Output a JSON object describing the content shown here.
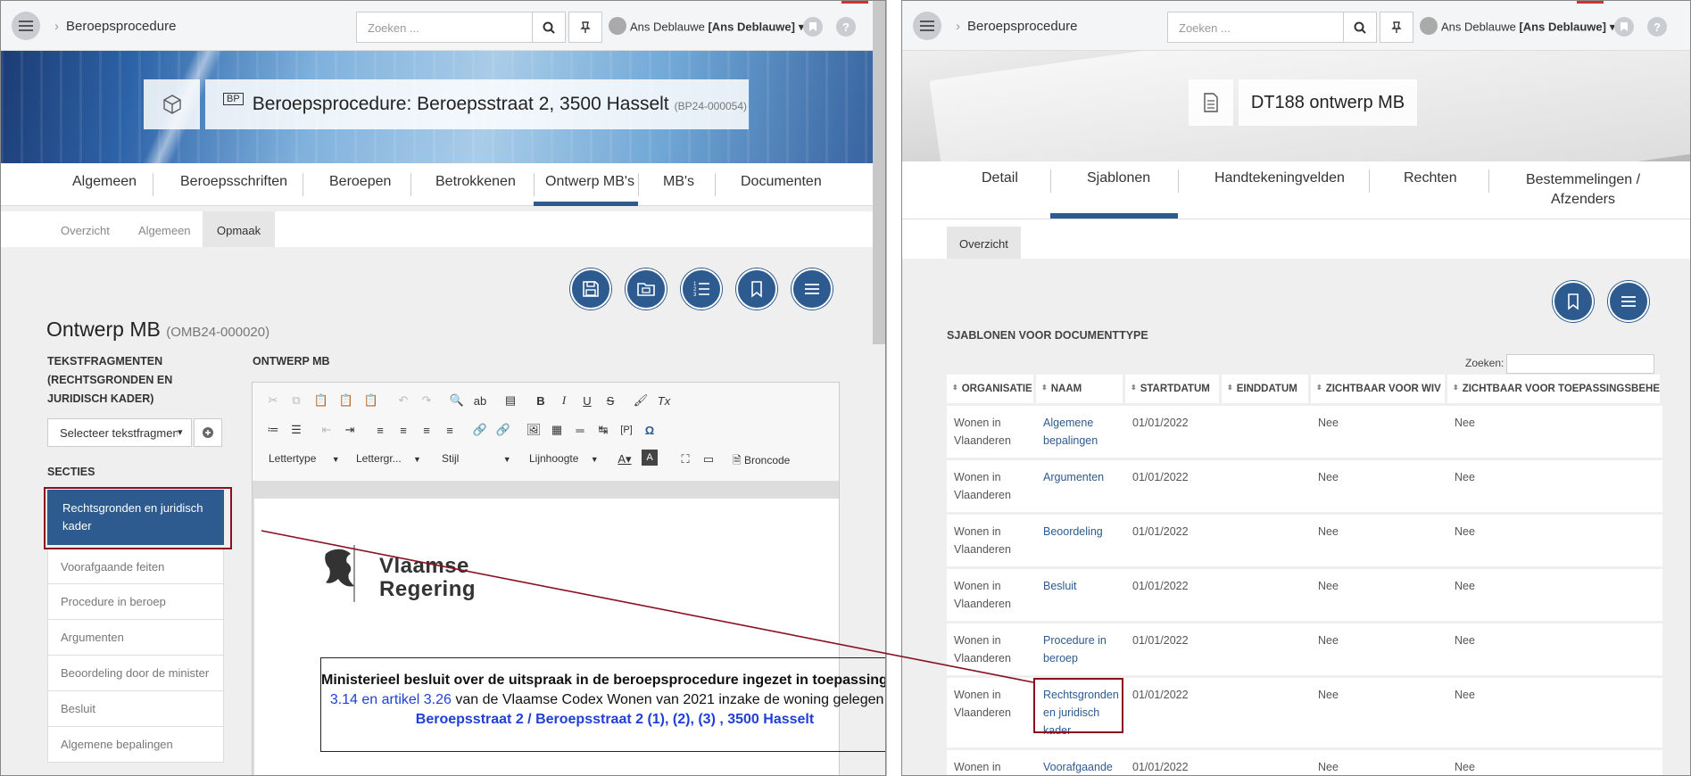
{
  "left": {
    "breadcrumb": "Beroepsprocedure",
    "search_placeholder": "Zoeken ...",
    "user": {
      "name": "Ans Deblauwe",
      "bracket": "[Ans Deblauwe]"
    },
    "banner": {
      "code": "BP",
      "title": "Beroepsprocedure: Beroepsstraat 2, 3500 Hasselt",
      "ref": "(BP24-000054)"
    },
    "tabs": [
      "Algemeen",
      "Beroepsschriften",
      "Beroepen",
      "Betrokkenen",
      "Ontwerp MB's",
      "MB's",
      "Documenten"
    ],
    "active_tab": "Ontwerp MB's",
    "subtabs": [
      "Overzicht",
      "Algemeen",
      "Opmaak"
    ],
    "active_subtab": "Opmaak",
    "page_title": "Ontwerp MB",
    "page_ref": "(OMB24-000020)",
    "fragments_label": "Tekstfragmenten (rechtsgronden en juridisch kader)",
    "fragment_select": "Selecteer tekstfragment",
    "sections_label": "Secties",
    "sections": [
      "Rechtsgronden en juridisch kader",
      "Voorafgaande feiten",
      "Procedure in beroep",
      "Argumenten",
      "Beoordeling door de minister",
      "Besluit",
      "Algemene bepalingen"
    ],
    "editor_label": "Ontwerp MB",
    "toolbar": {
      "font": "Lettertype",
      "size": "Lettergr...",
      "style": "Stijl",
      "lineheight": "Lijnhoogte",
      "source": "Broncode"
    },
    "doc": {
      "logo_line1": "Vlaamse",
      "logo_line2": "Regering",
      "heading_line1": "Ministerieel besluit over de uitspraak in de beroepsprocedure ingezet in toepassing van artikel",
      "heading_line2_blue": "3.14 en artikel 3.26",
      "heading_line2_rest": " van de Vlaamse Codex Wonen van 2021 inzake de woning gelegen te",
      "heading_line3": "Beroepsstraat 2 / Beroepsstraat 2 (1), (2), (3) , 3500 Hasselt"
    }
  },
  "right": {
    "breadcrumb": "Beroepsprocedure",
    "search_placeholder": "Zoeken ...",
    "user": {
      "name": "Ans Deblauwe",
      "bracket": "[Ans Deblauwe]"
    },
    "banner": {
      "title": "DT188 ontwerp MB"
    },
    "tabs": [
      "Detail",
      "Sjablonen",
      "Handtekeningvelden",
      "Rechten",
      "Bestemmelingen / Afzenders"
    ],
    "active_tab": "Sjablonen",
    "subtabs": [
      "Overzicht"
    ],
    "section_title": "Sjablonen voor documenttype",
    "search_label": "Zoeken:",
    "columns": [
      "Organisatie",
      "Naam",
      "Startdatum",
      "Einddatum",
      "Zichtbaar voor WIV",
      "Zichtbaar voor toepassingsbeheerder"
    ],
    "rows": [
      {
        "org": "Wonen in Vlaanderen",
        "naam": "Algemene bepalingen",
        "start": "01/01/2022",
        "eind": "",
        "wiv": "Nee",
        "tb": "Nee"
      },
      {
        "org": "Wonen in Vlaanderen",
        "naam": "Argumenten",
        "start": "01/01/2022",
        "eind": "",
        "wiv": "Nee",
        "tb": "Nee"
      },
      {
        "org": "Wonen in Vlaanderen",
        "naam": "Beoordeling",
        "start": "01/01/2022",
        "eind": "",
        "wiv": "Nee",
        "tb": "Nee"
      },
      {
        "org": "Wonen in Vlaanderen",
        "naam": "Besluit",
        "start": "01/01/2022",
        "eind": "",
        "wiv": "Nee",
        "tb": "Nee"
      },
      {
        "org": "Wonen in Vlaanderen",
        "naam": "Procedure in beroep",
        "start": "01/01/2022",
        "eind": "",
        "wiv": "Nee",
        "tb": "Nee"
      },
      {
        "org": "Wonen in Vlaanderen",
        "naam": "Rechtsgronden en juridisch kader",
        "start": "01/01/2022",
        "eind": "",
        "wiv": "Nee",
        "tb": "Nee"
      },
      {
        "org": "Wonen in Vlaanderen",
        "naam": "Voorafgaande feiten",
        "start": "01/01/2022",
        "eind": "",
        "wiv": "Nee",
        "tb": "Nee"
      }
    ]
  },
  "colors": {
    "primary": "#2d5a8f",
    "highlight": "#8a1020"
  }
}
